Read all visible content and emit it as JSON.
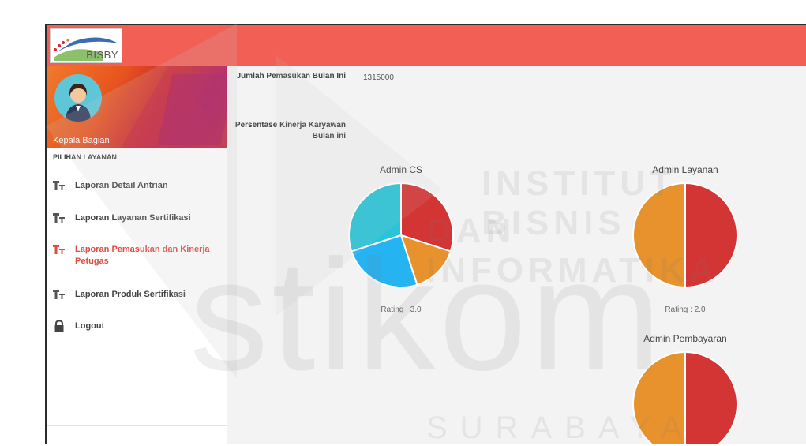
{
  "app": {
    "logo_text": "BISBY"
  },
  "sidebar": {
    "role": "Kepala Bagian",
    "section_title": "PILIHAN LAYANAN",
    "items": [
      {
        "label": "Laporan Detail Antrian",
        "icon": "text-format-icon",
        "active": false
      },
      {
        "label": "Laporan Layanan Sertifikasi",
        "icon": "text-format-icon",
        "active": false
      },
      {
        "label": "Laporan Pemasukan dan Kinerja Petugas",
        "icon": "text-format-icon",
        "active": true
      },
      {
        "label": "Laporan Produk Sertifikasi",
        "icon": "text-format-icon",
        "active": false
      },
      {
        "label": "Logout",
        "icon": "lock-icon",
        "active": false
      }
    ]
  },
  "main": {
    "income_label": "Jumlah Pemasukan Bulan Ini",
    "income_value": "1315000",
    "performance_label": "Persentase Kinerja Karyawan Bulan ini"
  },
  "chart_data": [
    {
      "type": "pie",
      "title": "Admin CS",
      "slices": [
        {
          "value": 30,
          "color": "#d33434"
        },
        {
          "value": 15,
          "color": "#e8922e"
        },
        {
          "value": 25,
          "color": "#25b3f2"
        },
        {
          "value": 30,
          "color": "#29c4d8"
        }
      ],
      "rating": "Rating : 3.0"
    },
    {
      "type": "pie",
      "title": "Admin Layanan",
      "slices": [
        {
          "value": 50,
          "color": "#d33434"
        },
        {
          "value": 50,
          "color": "#e8922e"
        }
      ],
      "rating": "Rating : 2.0"
    },
    {
      "type": "pie",
      "title": "Admin Pembayaran",
      "slices": [
        {
          "value": 50,
          "color": "#d33434"
        },
        {
          "value": 50,
          "color": "#e8922e"
        }
      ],
      "rating": ""
    }
  ],
  "watermark": {
    "line1": "INSTITUT BISNIS",
    "line2": "DAN INFORMATIKA",
    "brand": "stikom",
    "city": "SURABAYA"
  }
}
